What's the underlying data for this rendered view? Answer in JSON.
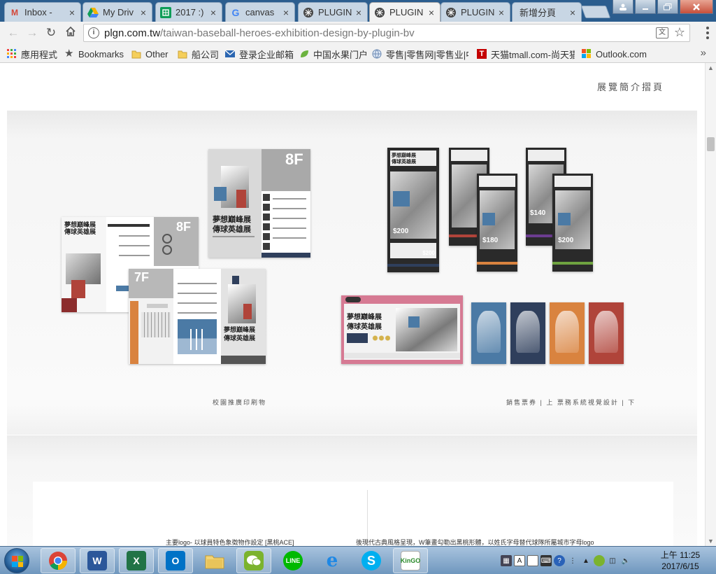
{
  "browser": {
    "tabs": [
      {
        "title": "Inbox -",
        "icon": "gmail-icon",
        "active": false
      },
      {
        "title": "My Driv",
        "icon": "google-drive-icon",
        "active": false
      },
      {
        "title": "2017 :)",
        "icon": "google-sheets-icon",
        "active": false
      },
      {
        "title": "canvas",
        "icon": "google-icon",
        "active": false
      },
      {
        "title": "PLUGIN",
        "icon": "plugin-site-icon",
        "active": false
      },
      {
        "title": "PLUGIN",
        "icon": "plugin-site-icon",
        "active": true
      },
      {
        "title": "PLUGIN",
        "icon": "plugin-site-icon",
        "active": false
      },
      {
        "title": "新增分頁",
        "icon": "",
        "active": false
      }
    ],
    "tab_close_glyph": "×",
    "url_host": "plgn.com.tw",
    "url_path": "/taiwan-baseball-heroes-exhibition-design-by-plugin-bv",
    "bookmarks": [
      {
        "label": "應用程式",
        "icon": "apps-grid-icon"
      },
      {
        "label": "Bookmarks",
        "icon": "star-icon"
      },
      {
        "label": "Other",
        "icon": "folder-icon"
      },
      {
        "label": "船公司",
        "icon": "folder-icon"
      },
      {
        "label": "登录企业邮箱",
        "icon": "mail-site-icon"
      },
      {
        "label": "中国水果门户",
        "icon": "leaf-icon"
      },
      {
        "label": "零售|零售网|零售业|中",
        "icon": "globe-icon"
      },
      {
        "label": "天猫tmall.com-尚天猫",
        "icon": "tmall-icon"
      },
      {
        "label": "Outlook.com",
        "icon": "windows-icon"
      }
    ],
    "bookmarks_more": "»"
  },
  "page": {
    "header": "展覽簡介摺頁",
    "caption_left": "校園推廣印刷物",
    "caption_right": "銷售票券 | 上  票務系統視覺設計 | 下",
    "lower_left": "主要logo- 以球員特色象徵物作設定 [黑桃ACE]",
    "lower_right": "後現代古典風格呈現，W筆畫勾勒出黑桃形體，以姓氏字母替代球隊所屬城市字母logo"
  },
  "artwork": {
    "poster_title": "夢想巔峰展",
    "poster_subtitle": "傳球英雄展",
    "floor_8f": "8F",
    "floor_7f": "7F",
    "ticket_prices": [
      "$200",
      "$200",
      "$180",
      "$140",
      "$200"
    ],
    "colors": {
      "navy": "#2f3f5c",
      "brick": "#b0443a",
      "steel": "#4b7aa5",
      "rose": "#d67a93",
      "purple": "#6b3c8f",
      "orange": "#d9833f",
      "green": "#6fa340"
    }
  },
  "taskbar": {
    "apps": [
      "chrome-icon",
      "word-icon",
      "excel-icon",
      "outlook-icon",
      "explorer-icon",
      "wechat-icon",
      "line-icon",
      "ie-icon",
      "skype-icon",
      "kingo-icon"
    ],
    "clock_time": "上午 11:25",
    "clock_date": "2017/6/15"
  }
}
